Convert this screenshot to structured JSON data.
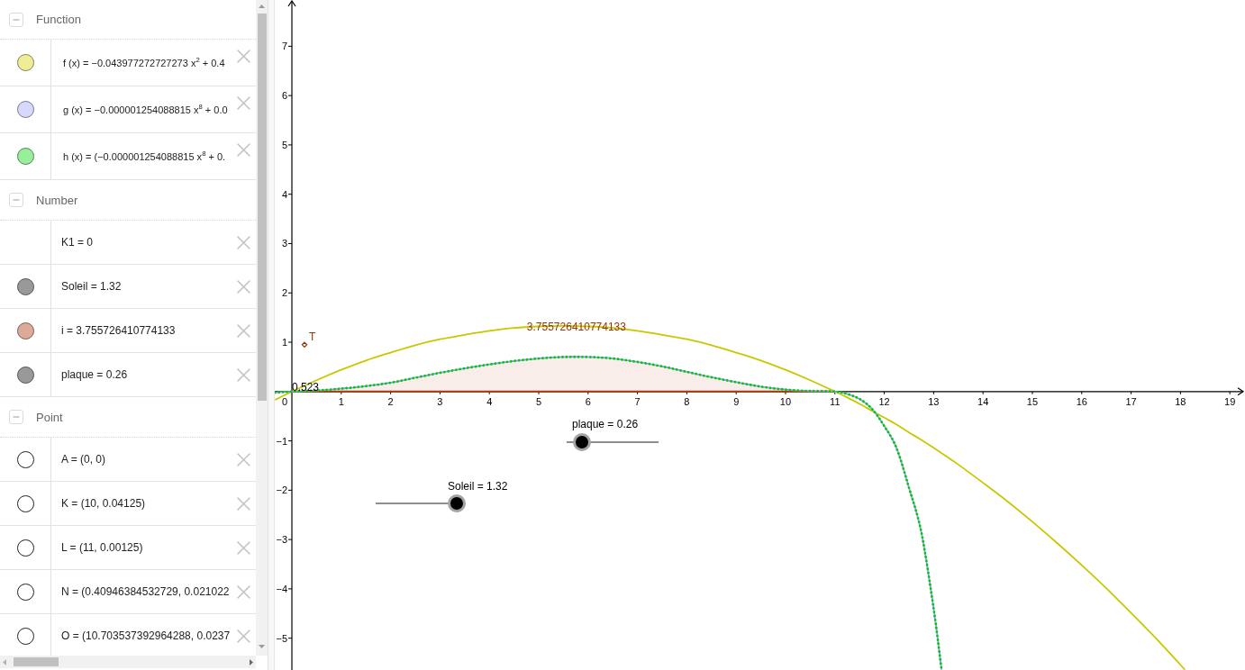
{
  "algebra_view": {
    "sections": [
      {
        "title": "Function",
        "expanded": true,
        "items": [
          {
            "text": "f (x) = −0.043977272727273 x$^{2}$ + 0.4",
            "kind": "filled",
            "color": "#eeee99"
          },
          {
            "text": "g (x) = −0.000001254088815 x$^{8}$ + 0.0",
            "kind": "filled",
            "color": "#d8d8ff"
          },
          {
            "text": "h (x) = (−0.000001254088815 x$^{8}$ + 0.",
            "kind": "filled",
            "color": "#99ee99"
          }
        ]
      },
      {
        "title": "Number",
        "expanded": true,
        "items": [
          {
            "text": "K1 = 0",
            "kind": "plain"
          },
          {
            "text": "Soleil = 1.32",
            "kind": "filled",
            "color": "#999999"
          },
          {
            "text": "i = 3.755726410774133",
            "kind": "filled",
            "color": "#ddaa99"
          },
          {
            "text": "plaque = 0.26",
            "kind": "filled",
            "color": "#999999"
          }
        ]
      },
      {
        "title": "Point",
        "expanded": true,
        "items": [
          {
            "text": "A = (0, 0)",
            "kind": "hollow"
          },
          {
            "text": "K = (10, 0.04125)",
            "kind": "hollow"
          },
          {
            "text": "L = (11, 0.00125)",
            "kind": "hollow"
          },
          {
            "text": "N = (0.40946384532729, 0.021022",
            "kind": "hollow"
          },
          {
            "text": "O = (10.703537392964288, 0.0237",
            "kind": "hollow"
          }
        ]
      }
    ]
  },
  "graphics_view": {
    "chart_data": {
      "type": "line",
      "xlim": [
        -0.347,
        19.307
      ],
      "ylim": [
        -5.645,
        7.938
      ],
      "xticks": [
        1,
        2,
        3,
        4,
        5,
        6,
        7,
        8,
        9,
        10,
        11,
        12,
        13,
        14,
        15,
        16,
        17,
        18,
        19
      ],
      "yticks": [
        {
          "value": -5,
          "label": "−5"
        },
        {
          "value": -4,
          "label": "−4"
        },
        {
          "value": -3,
          "label": "−3"
        },
        {
          "value": -2,
          "label": "−2"
        },
        {
          "value": -1,
          "label": "−1"
        },
        1,
        2,
        3,
        4,
        5,
        6,
        7
      ],
      "x": [
        -0.34,
        0,
        0.5,
        1,
        1.5,
        2,
        2.5,
        3,
        3.5,
        4,
        4.5,
        5,
        5.5,
        6,
        6.5,
        7,
        7.5,
        8,
        8.5,
        9,
        9.5,
        10,
        10.5,
        11,
        11.25,
        11.5,
        11.75,
        12,
        12.25,
        12.5,
        12.75,
        13,
        13.16,
        13.5,
        14,
        14.5,
        15,
        15.5,
        16,
        16.5,
        17,
        17.5,
        18,
        18.09
      ],
      "series": [
        {
          "color": "#c8c800",
          "line_style": "solid",
          "values": [
            -0.17,
            0,
            0.23,
            0.44,
            0.63,
            0.79,
            0.94,
            1.06,
            1.15,
            1.23,
            1.29,
            1.32,
            1.33,
            1.32,
            1.29,
            1.23,
            1.15,
            1.06,
            0.94,
            0.79,
            0.63,
            0.44,
            0.23,
            0,
            -0.12,
            -0.25,
            -0.39,
            -0.53,
            -0.67,
            -0.83,
            -0.98,
            -1.14,
            -1.25,
            -1.48,
            -1.85,
            -2.23,
            -2.64,
            -3.07,
            -3.52,
            -3.99,
            -4.49,
            -5.0,
            -5.54,
            -5.64
          ]
        },
        {
          "color": "#9999ff",
          "line_style": "solid",
          "values": [
            -0.02,
            0,
            0.02,
            0.06,
            0.11,
            0.18,
            0.28,
            0.38,
            0.47,
            0.55,
            0.62,
            0.67,
            0.7,
            0.7,
            0.67,
            0.6,
            0.51,
            0.4,
            0.29,
            0.19,
            0.1,
            0.04,
            0.01,
            0,
            -0.05,
            -0.15,
            -0.35,
            -0.7,
            -1.15,
            -1.95,
            -2.85,
            -4.4,
            -5.64,
            null,
            null,
            null,
            null,
            null,
            null,
            null,
            null,
            null,
            null,
            null
          ]
        },
        {
          "color": "#00cc00",
          "line_style": "dotted",
          "values": [
            -0.02,
            0,
            0.02,
            0.06,
            0.11,
            0.18,
            0.28,
            0.38,
            0.47,
            0.55,
            0.62,
            0.67,
            0.7,
            0.7,
            0.67,
            0.6,
            0.51,
            0.4,
            0.29,
            0.19,
            0.1,
            0.04,
            0.01,
            0,
            -0.05,
            -0.15,
            -0.35,
            -0.7,
            -1.15,
            -1.95,
            -2.85,
            -4.4,
            -5.64,
            null,
            null,
            null,
            null,
            null,
            null,
            null,
            null,
            null,
            null,
            null
          ]
        }
      ],
      "annotations": [
        {
          "text": "0.523",
          "x": 0,
          "y": 0.02
        }
      ]
    },
    "origin_label": "0",
    "integral": {
      "label": "3.755726410774133"
    },
    "points": [
      {
        "label": "T"
      }
    ],
    "sliders": [
      {
        "label": "plaque = 0.26",
        "level": 0.17
      },
      {
        "label": "Soleil = 1.32",
        "level": 0.9
      }
    ]
  }
}
